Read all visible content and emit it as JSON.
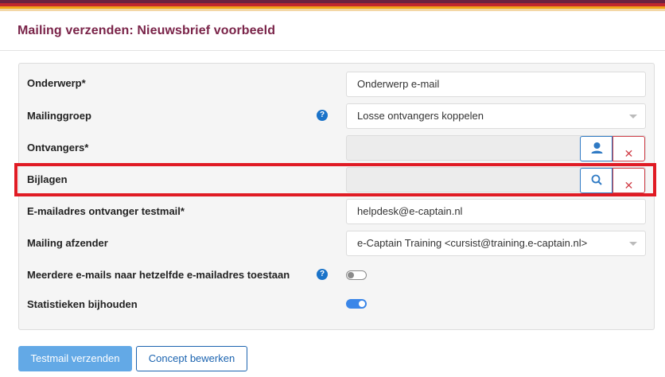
{
  "colors": {
    "title": "#7a2449",
    "highlight_border": "#e01b24",
    "primary_button": "#63a9e6",
    "toggle_on": "#3a86e8"
  },
  "page": {
    "title": "Mailing verzenden: Nieuwsbrief voorbeeld"
  },
  "form": {
    "subject": {
      "label": "Onderwerp*",
      "value": "Onderwerp e-mail"
    },
    "mailing_group": {
      "label": "Mailinggroep",
      "help": "?",
      "value": "Losse ontvangers koppelen"
    },
    "recipients": {
      "label": "Ontvangers*",
      "value": "",
      "button_icon": "user-icon",
      "clear_symbol": "✕"
    },
    "attachments": {
      "label": "Bijlagen",
      "value": "",
      "button_icon": "search-icon",
      "clear_symbol": "✕"
    },
    "test_email": {
      "label": "E-mailadres ontvanger testmail*",
      "value": "helpdesk@e-captain.nl"
    },
    "sender": {
      "label": "Mailing afzender",
      "value": "e-Captain Training <cursist@training.e-captain.nl>"
    },
    "allow_multiple": {
      "label": "Meerdere e-mails naar hetzelfde e-mailadres toestaan",
      "help": "?",
      "enabled": false
    },
    "statistics": {
      "label": "Statistieken bijhouden",
      "enabled": true
    }
  },
  "actions": {
    "send_test": "Testmail verzenden",
    "edit_draft": "Concept bewerken"
  }
}
